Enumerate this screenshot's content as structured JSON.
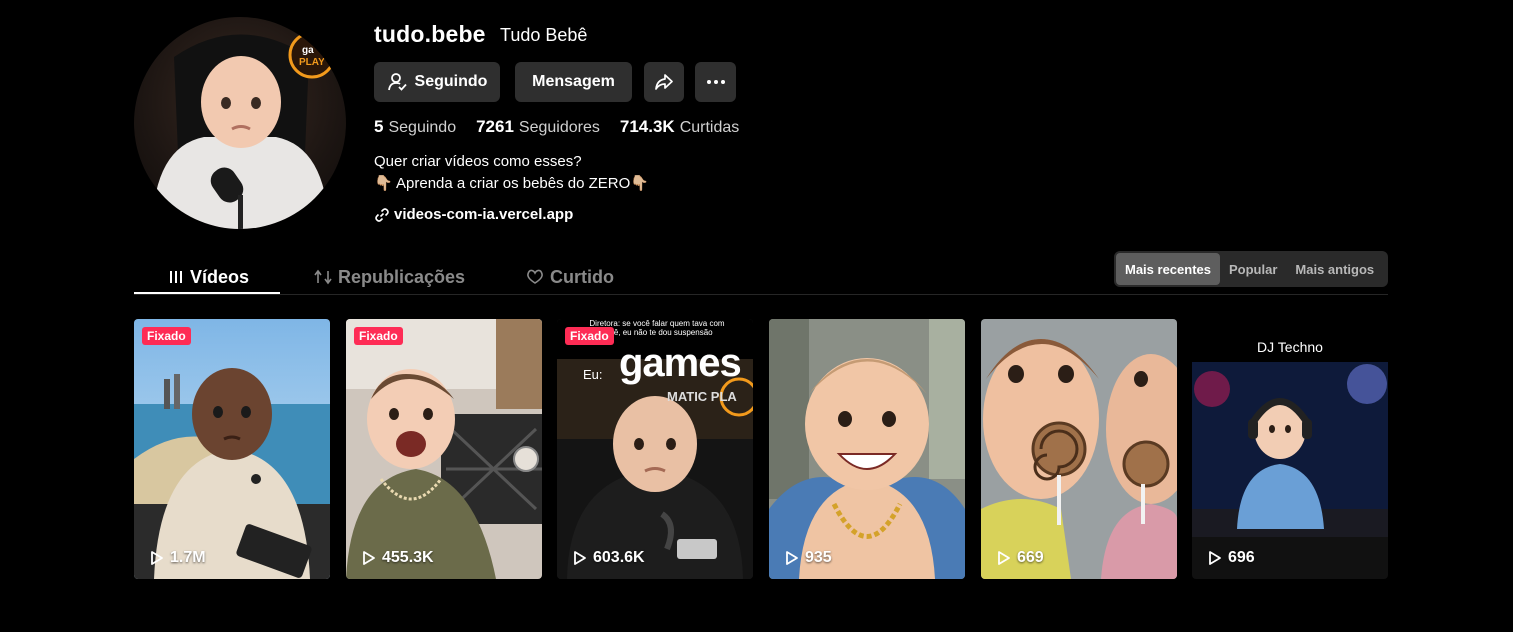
{
  "profile": {
    "username": "tudo.bebe",
    "nickname": "Tudo Bebê",
    "buttons": {
      "follow": "Seguindo",
      "message": "Mensagem"
    },
    "stats": [
      {
        "value": "5",
        "label": "Seguindo"
      },
      {
        "value": "7261",
        "label": "Seguidores"
      },
      {
        "value": "714.3K",
        "label": "Curtidas"
      }
    ],
    "bio": [
      "Quer criar vídeos como esses?",
      "👇🏼 Aprenda a criar os bebês do ZERO👇🏼"
    ],
    "link": "videos-com-ia.vercel.app"
  },
  "tabs": [
    "Vídeos",
    "Republicações",
    "Curtido"
  ],
  "sort": {
    "options": [
      "Mais recentes",
      "Popular",
      "Mais antigos"
    ],
    "selected": "Mais recentes"
  },
  "pinned_label": "Fixado",
  "videos": [
    {
      "views": "1.7M",
      "pinned": true
    },
    {
      "views": "455.3K",
      "pinned": true
    },
    {
      "views": "603.6K",
      "pinned": true,
      "overlay": {
        "caption": "Diretora: se você falar quem tava com você, eu não te dou suspensão",
        "eu": "Eu:",
        "games": "games",
        "matic": "MATIC PLA"
      }
    },
    {
      "views": "935",
      "pinned": false
    },
    {
      "views": "669",
      "pinned": false
    },
    {
      "views": "696",
      "pinned": false,
      "title": "DJ Techno"
    }
  ],
  "colors": {
    "accent": "#fe2c55",
    "button_bg": "#2f2f2f",
    "background": "#000000"
  }
}
